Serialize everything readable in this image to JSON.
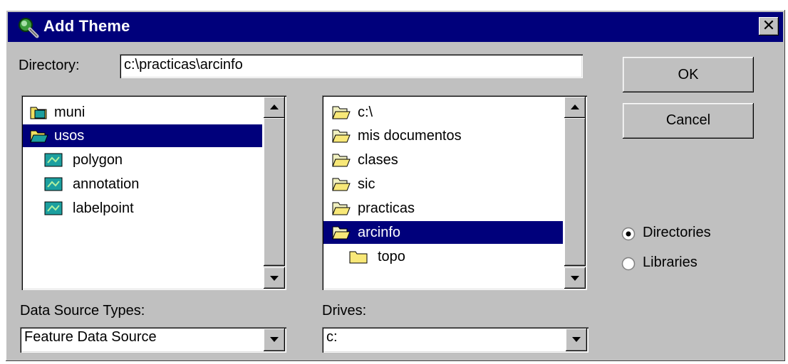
{
  "window": {
    "title": "Add Theme",
    "close_glyph": "✕"
  },
  "directory": {
    "label": "Directory:",
    "value": "c:\\practicas\\arcinfo"
  },
  "buttons": {
    "ok": "OK",
    "cancel": "Cancel"
  },
  "theme_list": {
    "items": [
      {
        "label": "muni",
        "icon": "coverage-folder-icon",
        "selected": false
      },
      {
        "label": "usos",
        "icon": "coverage-folder-open-icon",
        "selected": true
      },
      {
        "label": "polygon",
        "icon": "feature-class-icon",
        "selected": false
      },
      {
        "label": "annotation",
        "icon": "feature-class-icon",
        "selected": false
      },
      {
        "label": "labelpoint",
        "icon": "feature-class-icon",
        "selected": false
      }
    ]
  },
  "folder_list": {
    "items": [
      {
        "label": "c:\\",
        "icon": "folder-open-icon",
        "selected": false
      },
      {
        "label": "mis documentos",
        "icon": "folder-open-icon",
        "selected": false
      },
      {
        "label": "clases",
        "icon": "folder-open-icon",
        "selected": false
      },
      {
        "label": "sic",
        "icon": "folder-open-icon",
        "selected": false
      },
      {
        "label": "practicas",
        "icon": "folder-open-icon",
        "selected": false
      },
      {
        "label": "arcinfo",
        "icon": "folder-open-icon",
        "selected": true
      },
      {
        "label": "topo",
        "icon": "folder-closed-icon",
        "selected": false
      }
    ]
  },
  "data_source_types": {
    "label": "Data Source Types:",
    "value": "Feature Data Source"
  },
  "drives": {
    "label": "Drives:",
    "value": "c:"
  },
  "radio_group": {
    "options": [
      {
        "label": "Directories",
        "checked": true
      },
      {
        "label": "Libraries",
        "checked": false
      }
    ]
  },
  "colors": {
    "titlebar": "#00007b",
    "face": "#c0c0c0",
    "selection": "#00007b"
  }
}
